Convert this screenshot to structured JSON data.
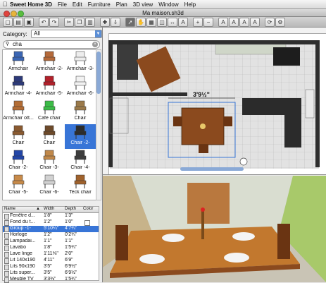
{
  "menubar": {
    "apple": "",
    "app_name": "Sweet Home 3D",
    "items": [
      "File",
      "Edit",
      "Furniture",
      "Plan",
      "3D view",
      "Window",
      "Help"
    ]
  },
  "window": {
    "title": "Ma maison.sh3d"
  },
  "toolbar": {
    "buttons": [
      {
        "name": "new-home-icon"
      },
      {
        "name": "open-icon"
      },
      {
        "name": "save-icon"
      },
      {
        "name": "undo-icon"
      },
      {
        "name": "redo-icon"
      },
      {
        "name": "cut-icon"
      },
      {
        "name": "copy-icon"
      },
      {
        "name": "paste-icon"
      },
      {
        "name": "add-furniture-icon"
      },
      {
        "name": "import-furniture-icon"
      },
      {
        "name": "select-mode-icon",
        "active": true
      },
      {
        "name": "pan-mode-icon"
      },
      {
        "name": "create-walls-icon"
      },
      {
        "name": "create-rooms-icon"
      },
      {
        "name": "create-dimensions-icon"
      },
      {
        "name": "add-text-icon"
      },
      {
        "name": "zoom-in-icon"
      },
      {
        "name": "zoom-out-icon"
      },
      {
        "name": "text-style-a-icon"
      },
      {
        "name": "text-style-b-icon"
      },
      {
        "name": "text-style-c-icon"
      },
      {
        "name": "text-style-d-icon"
      },
      {
        "name": "rotate-icon"
      },
      {
        "name": "preferences-icon"
      }
    ]
  },
  "catalog": {
    "category_label": "Category:",
    "category_value": "All",
    "search_value": "cha",
    "items": [
      {
        "label": "Armchair",
        "color": "#3b66b4"
      },
      {
        "label": "Armchair -2-",
        "color": "#b56a3a"
      },
      {
        "label": "Armchair -3-",
        "color": "#ededed"
      },
      {
        "label": "Armchair -4-",
        "color": "#2d3a7a"
      },
      {
        "label": "Armchair -5-",
        "color": "#b3202a"
      },
      {
        "label": "Armchair -6-",
        "color": "#f2f2f2"
      },
      {
        "label": "Armchair ott...",
        "color": "#b36d35"
      },
      {
        "label": "Cafe chair",
        "color": "#3cbc48"
      },
      {
        "label": "Chair",
        "color": "#9b7a4a"
      },
      {
        "label": "Chair",
        "color": "#8a5a30"
      },
      {
        "label": "Chair",
        "color": "#6d4a2a"
      },
      {
        "label": "Chair -2-",
        "color": "#2c2c2c",
        "selected": true
      },
      {
        "label": "Chair -2-",
        "color": "#2246a8"
      },
      {
        "label": "Chair -3-",
        "color": "#c0884a"
      },
      {
        "label": "Chair -4-",
        "color": "#3d3d3d"
      },
      {
        "label": "Chair -5-",
        "color": "#c88b4a"
      },
      {
        "label": "Chair -6-",
        "color": "#d2d2d2"
      },
      {
        "label": "Teck chair",
        "color": "#a0622c"
      }
    ]
  },
  "furniture_table": {
    "headers": [
      "Name",
      "Width",
      "Depth",
      "Color"
    ],
    "sort_indicator": "▲",
    "rows": [
      {
        "name": "Fenêtre d...",
        "width": "1'8\"",
        "depth": "1'3\""
      },
      {
        "name": "Fond du t...",
        "width": "1'2\"",
        "depth": "1'0\"",
        "check": true
      },
      {
        "name": "Group -1-",
        "width": "5'10¼\"",
        "depth": "4'7¾\"",
        "selected": true
      },
      {
        "name": "Horloge",
        "width": "1'2\"",
        "depth": "0'2¾\""
      },
      {
        "name": "Lampadai...",
        "width": "1'1\"",
        "depth": "1'1\""
      },
      {
        "name": "Lavabo",
        "width": "1'8\"",
        "depth": "1'5¾\""
      },
      {
        "name": "Lave linge",
        "width": "1'11⅝\"",
        "depth": "2'0\""
      },
      {
        "name": "Lit 140x190",
        "width": "4'11\"",
        "depth": "6'9\""
      },
      {
        "name": "Lits 90x190",
        "width": "3'5\"",
        "depth": "6'9½\""
      },
      {
        "name": "Lits super...",
        "width": "3'5\"",
        "depth": "6'9½\""
      },
      {
        "name": "Meuble TV",
        "width": "3'3⅜\"",
        "depth": "1'5¾\""
      }
    ]
  },
  "plan": {
    "dimension_label": "3'9½\""
  },
  "colors": {
    "selection": "#3875d7",
    "wall": "#3a3a3a",
    "floor_tile": "#d9d9d9",
    "table_wood": "#8b4a1e",
    "sofa": "#2b2b2b"
  }
}
